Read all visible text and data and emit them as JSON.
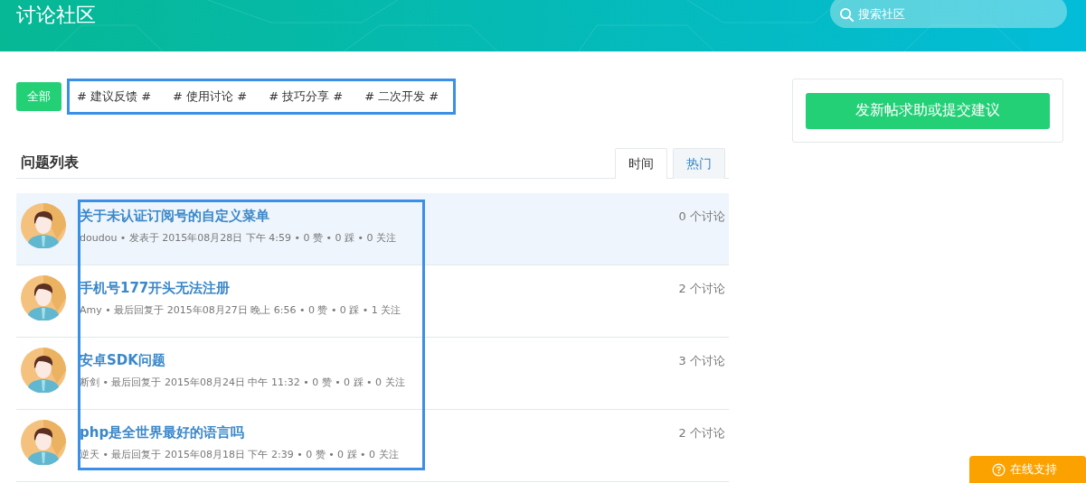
{
  "header": {
    "title": "讨论社区",
    "search": {
      "placeholder": "搜索社区"
    }
  },
  "filters": [
    {
      "label": "全部",
      "selected": true
    },
    {
      "label": "# 建议反馈 #",
      "selected": false
    },
    {
      "label": "# 使用讨论 #",
      "selected": false
    },
    {
      "label": "# 技巧分享 #",
      "selected": false
    },
    {
      "label": "# 二次开发 #",
      "selected": false
    }
  ],
  "list": {
    "title": "问题列表",
    "tabs": [
      {
        "label": "时间",
        "selected": true
      },
      {
        "label": "热门",
        "selected": false
      }
    ],
    "posts": [
      {
        "title": "关于未认证订阅号的自定义菜单",
        "meta": "doudou • 发表于 2015年08月28日 下午 4:59 • 0 赞 • 0 踩 • 0 关注",
        "count": "0 个讨论",
        "selected": true
      },
      {
        "title": "手机号177开头无法注册",
        "meta": "Amy • 最后回复于 2015年08月27日 晚上 6:56 • 0 赞 • 0 踩 • 1 关注",
        "count": "2 个讨论",
        "selected": false
      },
      {
        "title": "安卓SDK问题",
        "meta": "断剑 • 最后回复于 2015年08月24日 中午 11:32 • 0 赞 • 0 踩 • 0 关注",
        "count": "3 个讨论",
        "selected": false
      },
      {
        "title": "php是全世界最好的语言吗",
        "meta": "逆天 • 最后回复于 2015年08月18日 下午 2:39 • 0 赞 • 0 踩 • 0 关注",
        "count": "2 个讨论",
        "selected": false
      }
    ]
  },
  "new_post_button": "发新帖求助或提交建议",
  "support_button": "在线支持"
}
